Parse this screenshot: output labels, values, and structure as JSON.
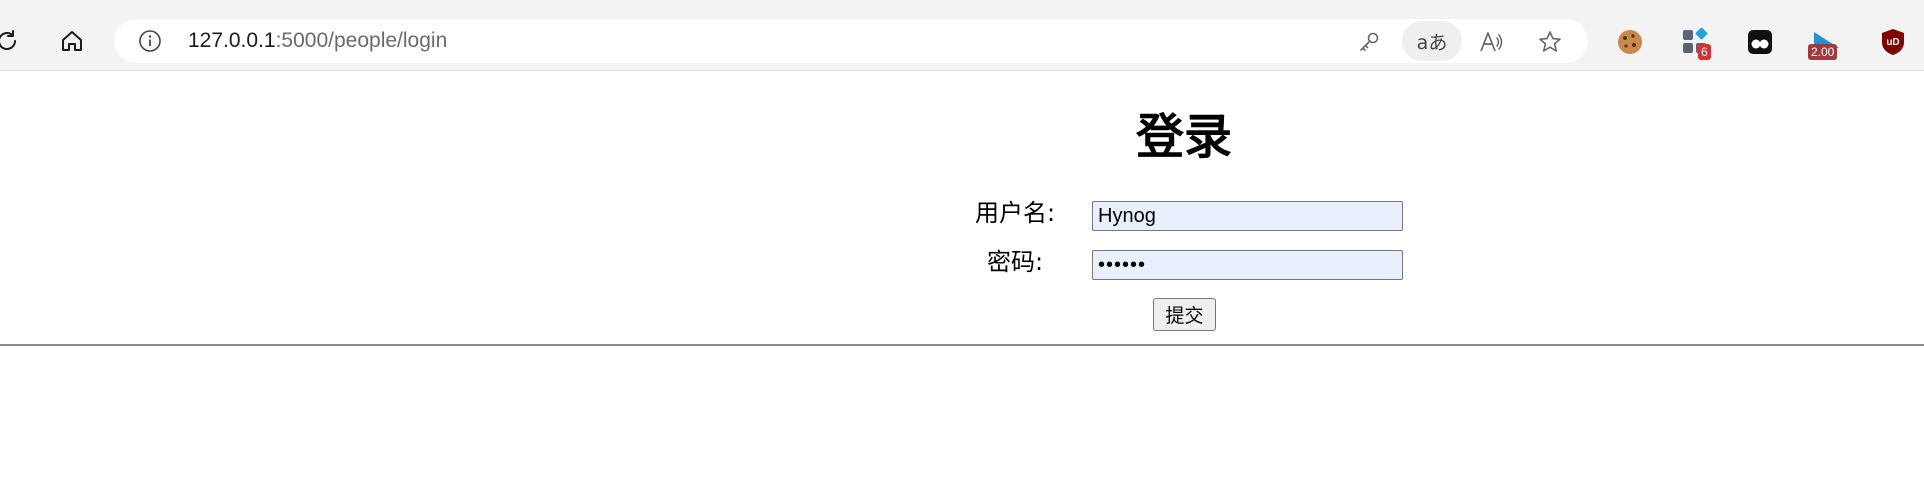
{
  "browser": {
    "url_host": "127.0.0.1",
    "url_rest": ":5000/people/login",
    "translate_label": "aあ",
    "extensions": {
      "badge_count": "6",
      "speed_badge": "2.00",
      "ublock_label": "uD"
    }
  },
  "page": {
    "title": "登录",
    "username_label": "用户名:",
    "username_value": "Hynog",
    "password_label": "密码:",
    "password_value": "••••••",
    "submit_label": "提交"
  },
  "colors": {
    "autofill_bg": "#e8f0fe",
    "chrome_bg": "#f3f3f3"
  }
}
